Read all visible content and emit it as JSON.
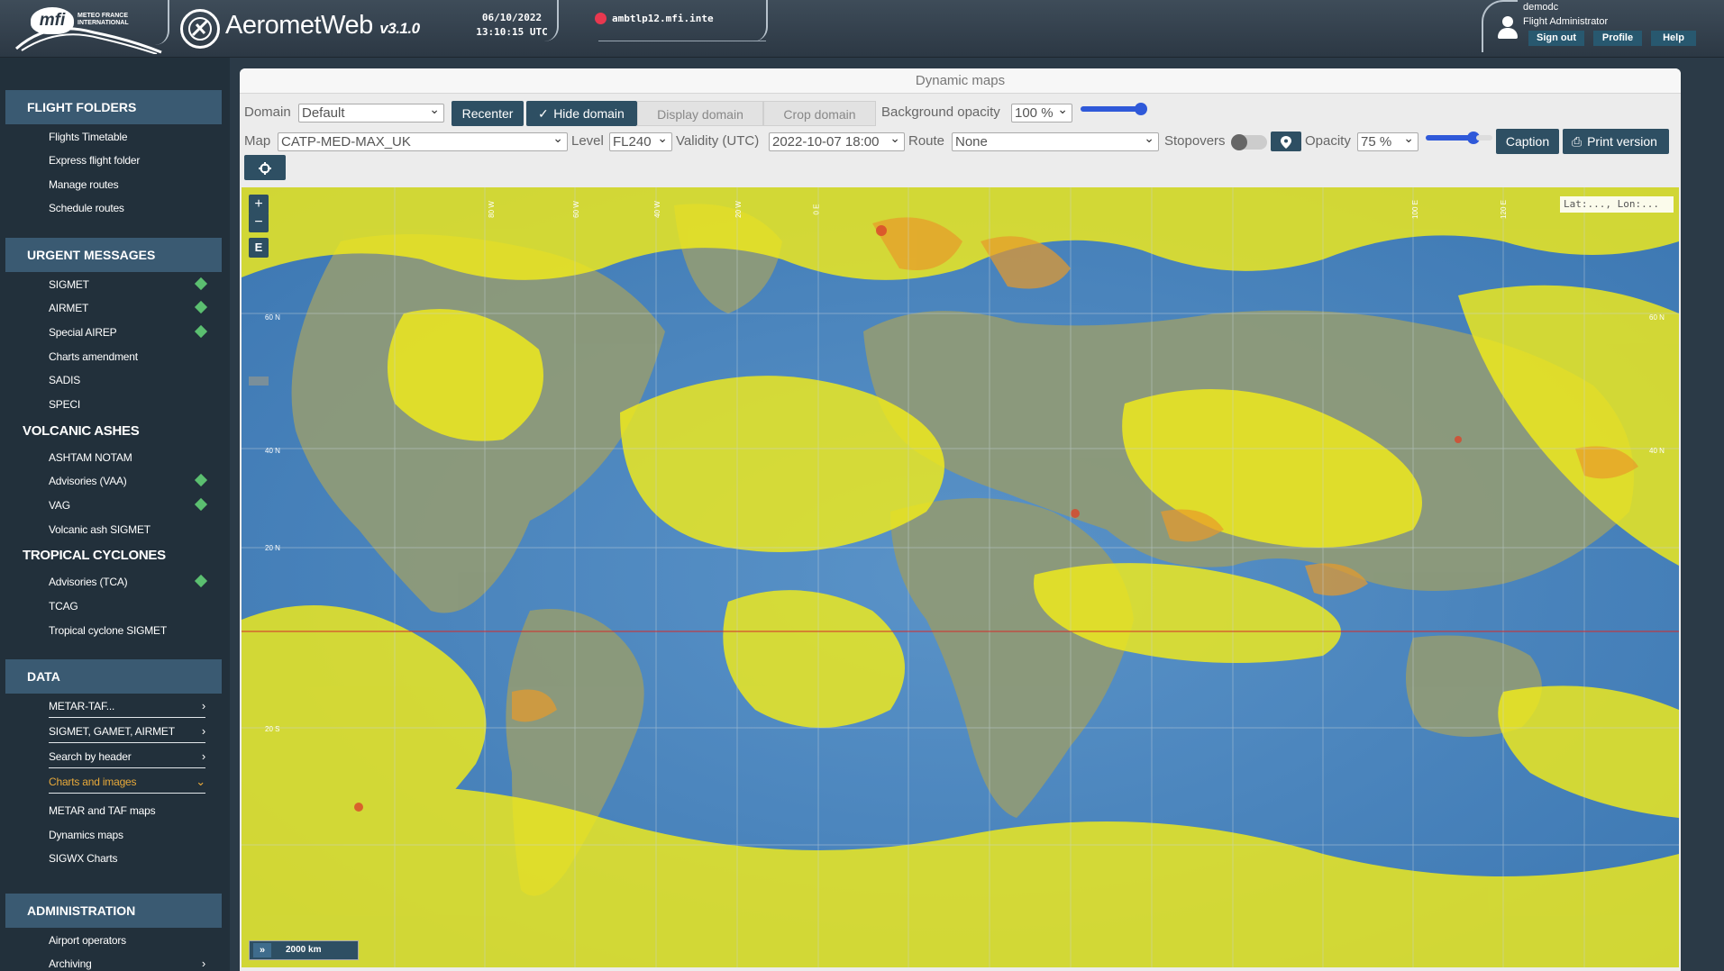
{
  "header": {
    "org_logo_text": "mfi",
    "org_name_line1": "METEO FRANCE",
    "org_name_line2": "INTERNATIONAL",
    "app_name": "AerometWeb",
    "app_version": "v3.1.0",
    "date": "06/10/2022",
    "time": "13:10:15 UTC",
    "server": "ambtlp12.mfi.inte",
    "server_status_color": "#e8384f",
    "user_name": "demodc",
    "user_role": "Flight Administrator",
    "sign_out_label": "Sign out",
    "profile_label": "Profile",
    "help_label": "Help"
  },
  "sidebar": {
    "flight_folders": {
      "title": "FLIGHT FOLDERS",
      "items": [
        "Flights Timetable",
        "Express flight folder",
        "Manage routes",
        "Schedule routes"
      ]
    },
    "urgent_messages": {
      "title": "URGENT MESSAGES",
      "items": [
        "SIGMET",
        "AIRMET",
        "Special AIREP",
        "Charts amendment",
        "SADIS",
        "SPECI"
      ]
    },
    "volcanic_ashes": {
      "title": "VOLCANIC ASHES",
      "items": [
        "ASHTAM NOTAM",
        "Advisories (VAA)",
        "VAG",
        "Volcanic ash SIGMET"
      ]
    },
    "tropical_cyclones": {
      "title": "TROPICAL CYCLONES",
      "items": [
        "Advisories (TCA)",
        "TCAG",
        "Tropical cyclone SIGMET"
      ]
    },
    "data": {
      "title": "DATA",
      "items": [
        "METAR-TAF...",
        "SIGMET, GAMET, AIRMET",
        "Search by header",
        "Charts and images",
        "METAR and TAF maps",
        "Dynamics maps",
        "SIGWX Charts"
      ]
    },
    "administration": {
      "title": "ADMINISTRATION",
      "items": [
        "Airport operators",
        "Archiving"
      ]
    },
    "alert_color": "#5bbf70",
    "active_color": "#e8a93a"
  },
  "panel": {
    "title": "Dynamic maps",
    "domain_label": "Domain",
    "domain_value": "Default",
    "recenter_label": "Recenter",
    "hide_domain_label": "Hide domain",
    "display_domain_label": "Display domain",
    "crop_domain_label": "Crop domain",
    "bg_opacity_label": "Background opacity",
    "bg_opacity_value": "100 %",
    "map_label": "Map",
    "map_value": "CATP-MED-MAX_UK",
    "level_label": "Level",
    "level_value": "FL240",
    "validity_label": "Validity (UTC)",
    "validity_value": "2022-10-07 18:00",
    "route_label": "Route",
    "route_value": "None",
    "stopovers_label": "Stopovers",
    "opacity_label": "Opacity",
    "opacity_value": "75 %",
    "caption_label": "Caption",
    "print_label": "Print version",
    "accent_color": "#2e4f63",
    "slider_color": "#2f59d9"
  },
  "map": {
    "zoom_in": "+",
    "zoom_out": "−",
    "edit_btn": "E",
    "coord_readout": "Lat:..., Lon:...",
    "scale_label": "2000 km",
    "scale_arrow": "»",
    "lat_labels": [
      "60 N",
      "40 N",
      "20 N",
      "20 S",
      "60 N",
      "40 N"
    ],
    "lon_labels": [
      "80 W",
      "60 W",
      "40 W",
      "20 W",
      "0 E",
      "100 E",
      "120 E"
    ]
  }
}
